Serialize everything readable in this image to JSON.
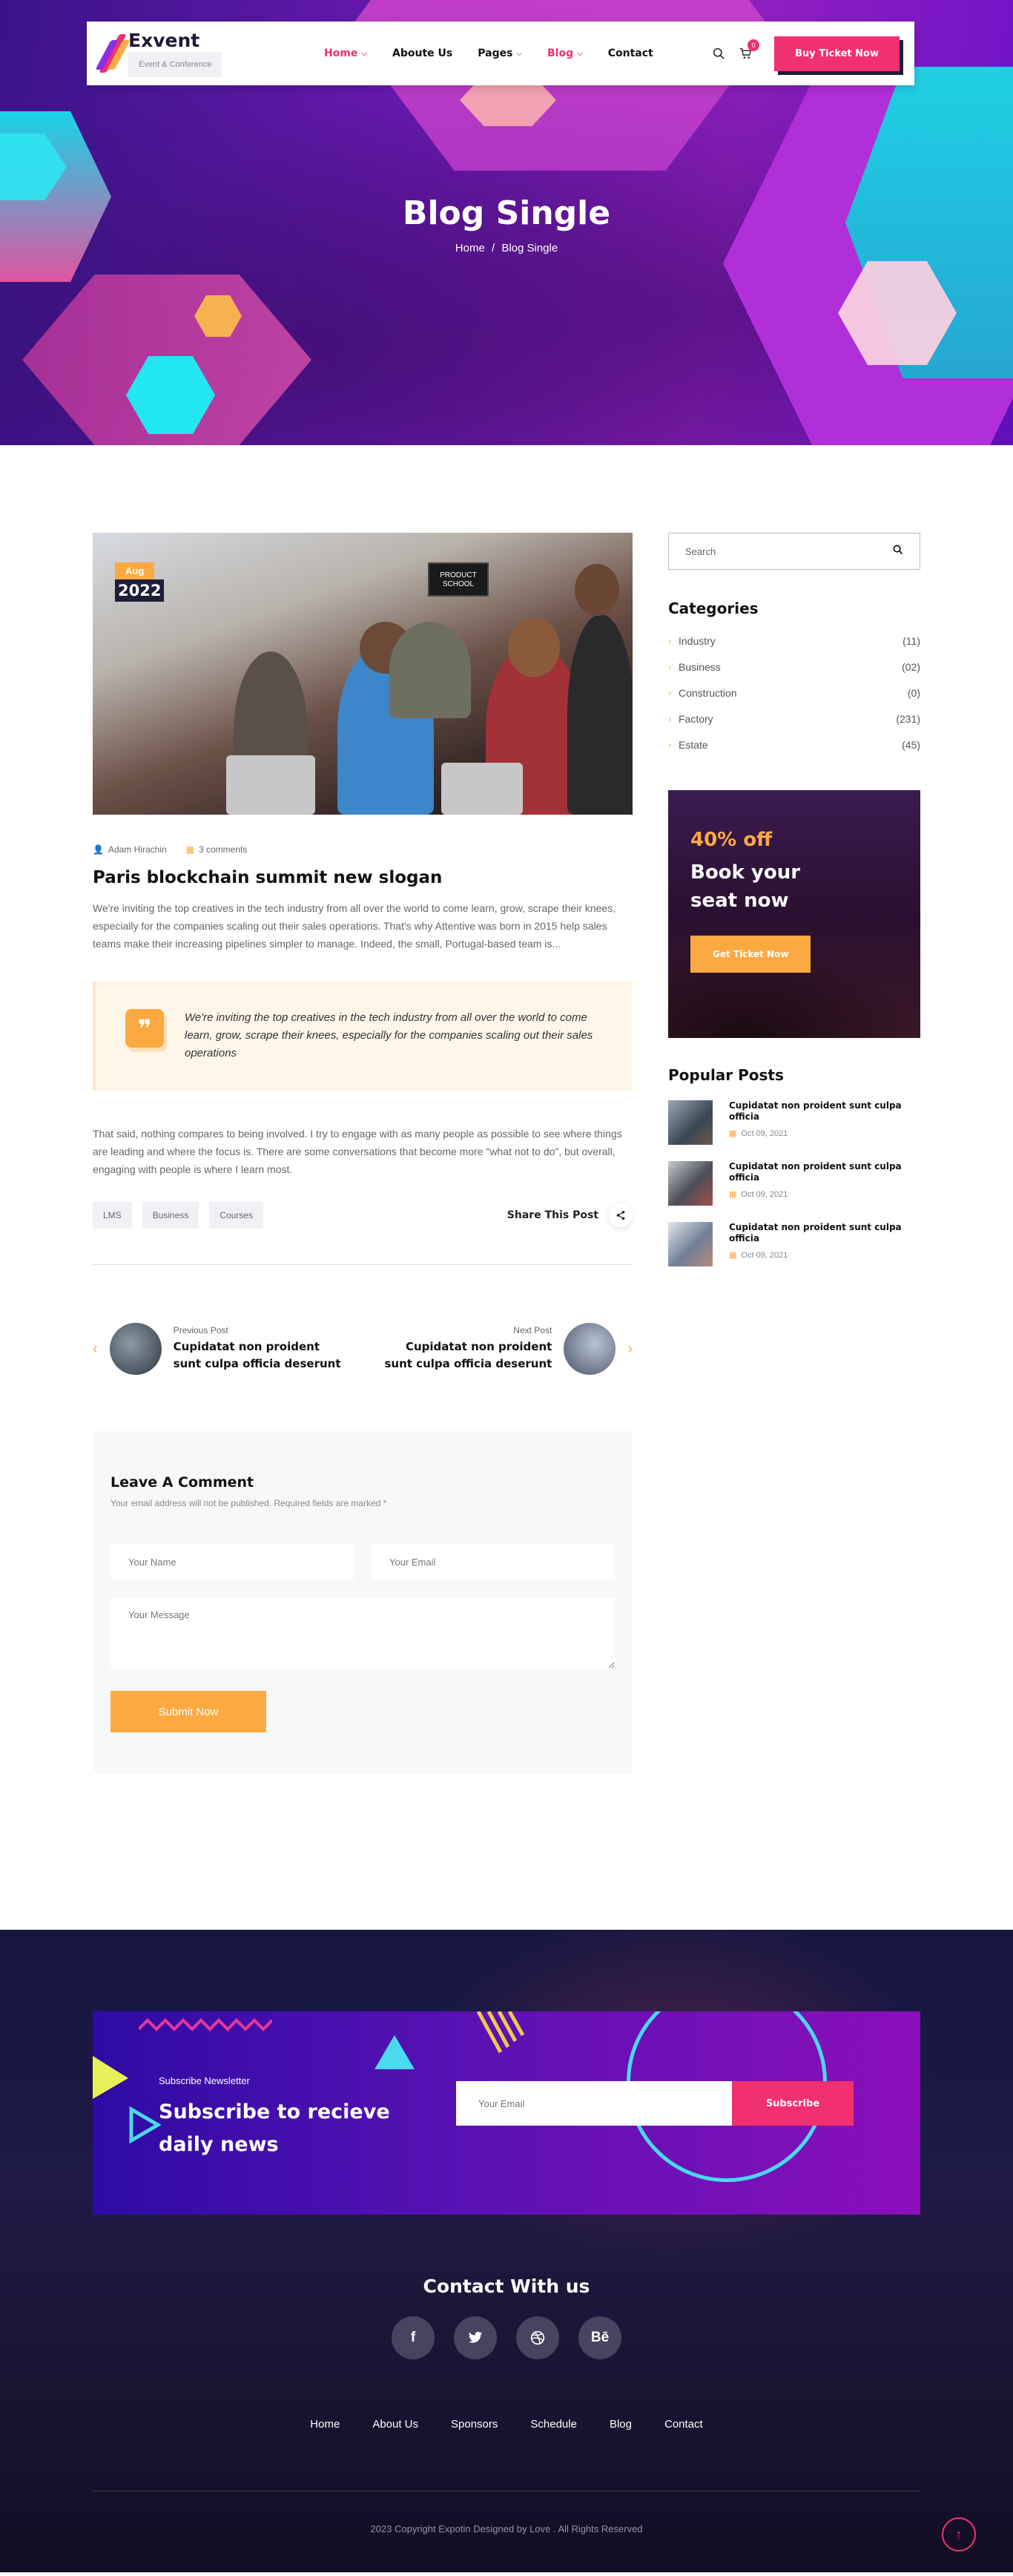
{
  "header": {
    "logo_name": "Exvent",
    "logo_tagline": "Event & Conference",
    "nav": [
      {
        "label": "Home",
        "chevron": true,
        "active": true
      },
      {
        "label": "Aboute Us",
        "chevron": false,
        "active": false
      },
      {
        "label": "Pages",
        "chevron": true,
        "active": false
      },
      {
        "label": "Blog",
        "chevron": true,
        "active": true
      },
      {
        "label": "Contact",
        "chevron": false,
        "active": false
      }
    ],
    "cart_count": "0",
    "buy_button": "Buy Ticket Now"
  },
  "hero": {
    "title": "Blog Single",
    "crumb_home": "Home",
    "crumb_sep": "/",
    "crumb_current": "Blog Single"
  },
  "post": {
    "date_month": "Aug",
    "date_year": "2022",
    "image_sign": "PRODUCT SCHOOL",
    "author": "Adam Hirachin",
    "comments": "3 comments",
    "title": "Paris blockchain summit new slogan",
    "paragraph_1": "We're inviting the top creatives in the tech industry from all over the world to come learn, grow, scrape their knees, especially for the companies scaling out their sales operations. That's why Attentive was born in 2015 help sales teams make their increasing pipelines simpler to manage. Indeed, the small, Portugal-based team is...",
    "quote": "We're inviting the top creatives in the tech industry from all over the world to come learn, grow, scrape their knees, especially for the companies scaling out their sales operations",
    "paragraph_2": "That said, nothing compares to being involved. I try to engage with as many people as possible to see where things are leading and where the focus is. There are some conversations that become more \"what not to do\", but overall, engaging with people is where I learn most.",
    "tags": [
      "LMS",
      "Business",
      "Courses"
    ],
    "share_label": "Share This Post"
  },
  "post_nav": {
    "prev_label": "Previous Post",
    "prev_title": "Cupidatat non proident sunt culpa officia deserunt",
    "next_label": "Next Post",
    "next_title": "Cupidatat non proident sunt culpa officia deserunt"
  },
  "comment_form": {
    "title": "Leave A Comment",
    "note": "Your email address will not be published. Required fields are marked *",
    "name_placeholder": "Your Name",
    "email_placeholder": "Your Email",
    "message_placeholder": "Your Message",
    "submit": "Submit Now"
  },
  "sidebar": {
    "search_placeholder": "Search",
    "categories_title": "Categories",
    "categories": [
      {
        "name": "Industry",
        "count": "(11)"
      },
      {
        "name": "Business",
        "count": "(02)"
      },
      {
        "name": "Construction",
        "count": "(0)"
      },
      {
        "name": "Factory",
        "count": "(231)"
      },
      {
        "name": "Estate",
        "count": "(45)"
      }
    ],
    "promo_discount": "40% off",
    "promo_heading": "Book your seat now",
    "promo_button": "Get Ticket Now",
    "popular_title": "Popular Posts",
    "popular": [
      {
        "title": "Cupidatat non proident sunt culpa officia",
        "date": "Oct 09, 2021"
      },
      {
        "title": "Cupidatat non proident sunt culpa officia",
        "date": "Oct 09, 2021"
      },
      {
        "title": "Cupidatat non proident sunt culpa officia",
        "date": "Oct 09, 2021"
      }
    ]
  },
  "footer": {
    "subscribe_label": "Subscribe Newsletter",
    "subscribe_heading": "Subscribe to recieve daily news",
    "email_placeholder": "Your Email",
    "subscribe_button": "Subscribe",
    "contact_title": "Contact With us",
    "socials": [
      {
        "icon": "facebook-icon",
        "glyph": "f"
      },
      {
        "icon": "twitter-icon",
        "glyph": "🐦"
      },
      {
        "icon": "dribbble-icon",
        "glyph": "⚽"
      },
      {
        "icon": "behance-icon",
        "glyph": "Bē"
      }
    ],
    "links": [
      "Home",
      "About Us",
      "Sponsors",
      "Schedule",
      "Blog",
      "Contact"
    ],
    "copyright": "2023 Copyright Expotin Designed by Love . All Rights Reserved"
  },
  "colors": {
    "accent_pink": "#f1306f",
    "accent_orange": "#fbaa42",
    "navy": "#1c1c3a"
  }
}
